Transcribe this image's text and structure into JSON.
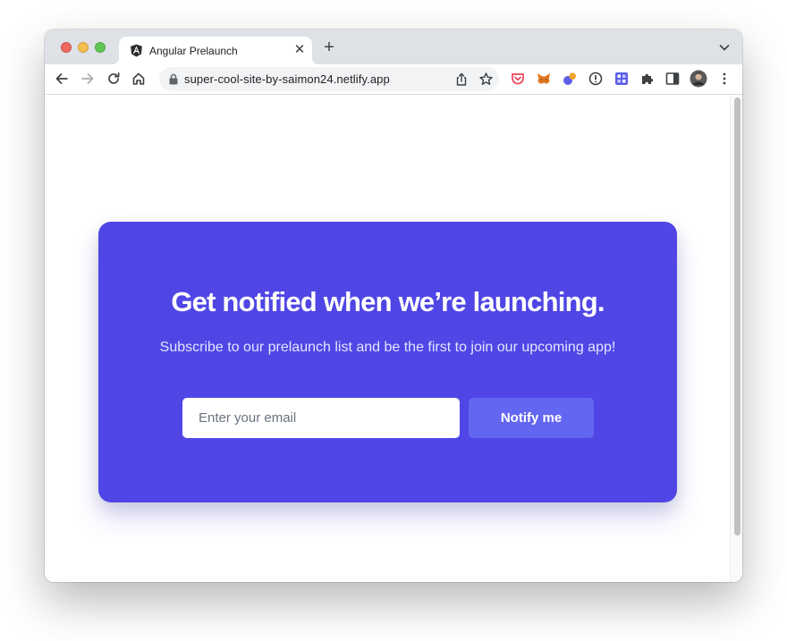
{
  "browser": {
    "tab": {
      "title": "Angular Prelaunch",
      "favicon": "angular-logo-icon",
      "close_icon": "close-icon"
    },
    "new_tab_icon": "plus-icon",
    "tab_search_icon": "chevron-down-icon",
    "url": "super-cool-site-by-saimon24.netlify.app",
    "nav_icons": [
      "back-arrow-icon",
      "forward-arrow-icon",
      "reload-icon",
      "home-icon"
    ],
    "omnibox_icons": [
      "lock-icon",
      "share-icon",
      "star-icon"
    ],
    "extension_icons": [
      "pocket-icon",
      "metamask-icon",
      "extension-coins-icon",
      "info-icon",
      "extension-grid-icon",
      "puzzle-icon",
      "side-panel-icon",
      "avatar",
      "kebab-menu-icon"
    ]
  },
  "page": {
    "heading": "Get notified when we’re launching.",
    "subheading": "Subscribe to our prelaunch list and be the first to join our upcoming app!",
    "email_input": {
      "value": "",
      "placeholder": "Enter your email"
    },
    "notify_button": "Notify me"
  },
  "colors": {
    "card_background": "#4f46e5",
    "button_background": "#6366f1",
    "tabstrip_background": "#dee1e6"
  }
}
